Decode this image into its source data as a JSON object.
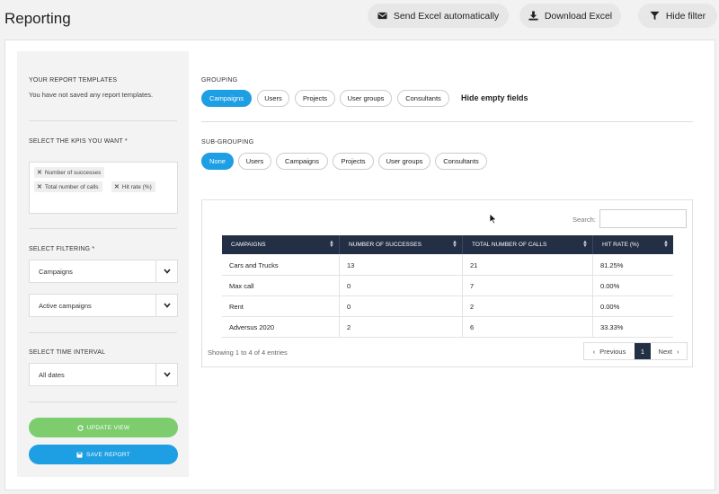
{
  "header": {
    "title": "Reporting",
    "send_excel": "Send Excel automatically",
    "download_excel": "Download Excel",
    "hide_filter": "Hide filter"
  },
  "sidebar": {
    "templates_heading": "YOUR REPORT TEMPLATES",
    "templates_empty": "You have not saved any report templates.",
    "kpi_heading": "SELECT THE KPIS YOU WANT *",
    "kpis": [
      "Number of successes",
      "Total number of calls",
      "Hit rate (%)"
    ],
    "filtering_heading": "SELECT FILTERING *",
    "filter_type": "Campaigns",
    "filter_value": "Active campaigns",
    "time_heading": "SELECT TIME INTERVAL",
    "time_value": "All dates",
    "update_label": "UPDATE VIEW",
    "save_label": "SAVE REPORT"
  },
  "grouping": {
    "label": "GROUPING",
    "options": [
      "Campaigns",
      "Users",
      "Projects",
      "User groups",
      "Consultants"
    ],
    "active": "Campaigns",
    "hide_empty": "Hide empty fields"
  },
  "subgrouping": {
    "label": "SUB-GROUPING",
    "options": [
      "None",
      "Users",
      "Campaigns",
      "Projects",
      "User groups",
      "Consultants"
    ],
    "active": "None"
  },
  "table": {
    "search_label": "Search:",
    "columns": [
      "CAMPAIGNS",
      "NUMBER OF SUCCESSES",
      "TOTAL NUMBER OF CALLS",
      "HIT RATE (%)"
    ],
    "rows": [
      [
        "Cars and Trucks",
        "13",
        "21",
        "81.25%"
      ],
      [
        "Max call",
        "0",
        "7",
        "0.00%"
      ],
      [
        "Rent",
        "0",
        "2",
        "0.00%"
      ],
      [
        "Adversus 2020",
        "2",
        "6",
        "33.33%"
      ]
    ],
    "entries_info": "Showing 1 to 4 of 4 entries",
    "pager": {
      "previous": "Previous",
      "current": "1",
      "next": "Next"
    }
  },
  "colors": {
    "accent": "#1e9ee3",
    "update_green": "#7dcd6e",
    "table_header": "#232f45"
  }
}
